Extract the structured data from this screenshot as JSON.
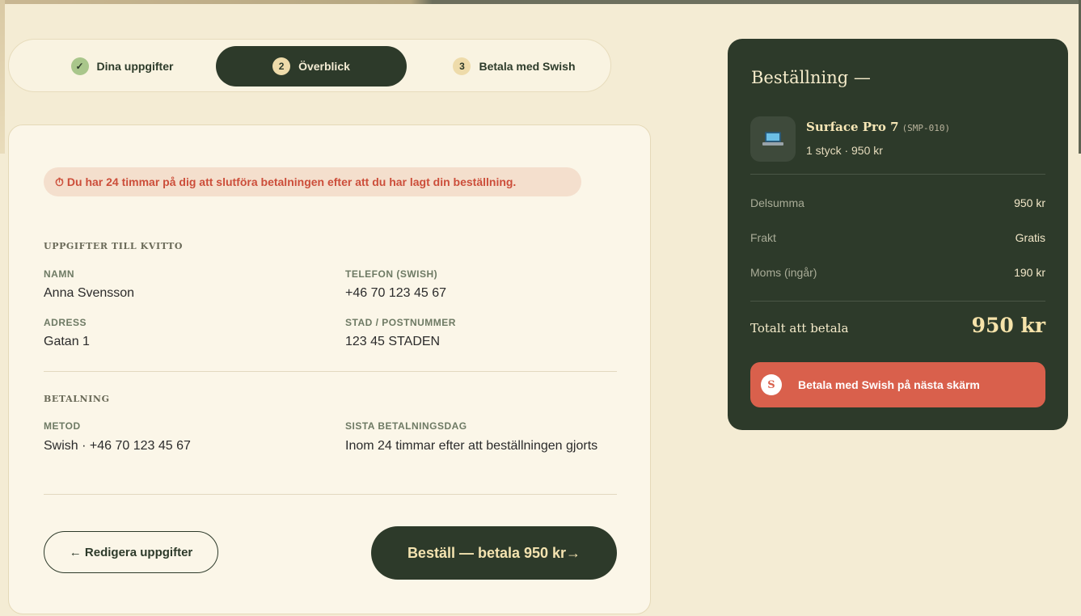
{
  "stepper": {
    "steps": [
      {
        "num": "✓",
        "label": "Dina uppgifter"
      },
      {
        "num": "2",
        "label": "Överblick"
      },
      {
        "num": "3",
        "label": "Betala med Swish"
      }
    ]
  },
  "alert": {
    "icon": "⏱",
    "text": "Du har 24 timmar på dig att slutföra betalningen efter att du har lagt din beställning."
  },
  "receipt": {
    "title": "UPPGIFTER TILL KVITTO",
    "name_label": "NAMN",
    "name_value": "Anna Svensson",
    "phone_label": "TELEFON (SWISH)",
    "phone_value": "+46 70 123 45 67",
    "address_label": "ADRESS",
    "address_value": "Gatan 1",
    "city_label": "STAD / POSTNUMMER",
    "city_value": "123 45 STADEN"
  },
  "payment": {
    "title": "BETALNING",
    "method_label": "METOD",
    "method_value": "Swish · +46 70 123 45 67",
    "deadline_label": "SISTA BETALNINGSDAG",
    "deadline_value": "Inom 24 timmar efter att beställningen gjorts"
  },
  "actions": {
    "edit_label": "← Redigera uppgifter",
    "order_label": "Beställ — betala 950  kr→"
  },
  "order_summary": {
    "title": "Beställning —",
    "product": {
      "name": "Surface Pro 7",
      "sku": "(SMP-010)",
      "sub": "1 styck · 950 kr",
      "icon": "laptop-icon"
    },
    "rows": [
      {
        "label": "Delsumma",
        "value": "950 kr"
      },
      {
        "label": "Frakt",
        "value": "Gratis"
      },
      {
        "label": "Moms (ingår)",
        "value": "190 kr"
      }
    ],
    "total_label": "Totalt att betala",
    "total_value": "950 kr",
    "swish_logo": "S",
    "swish_button": "Betala med Swish på nästa skärm"
  },
  "colors": {
    "background": "#f4ecd4",
    "dark_green": "#2d3a2a",
    "accent_red": "#d9604c",
    "alert_bg": "#f4dfcd"
  }
}
